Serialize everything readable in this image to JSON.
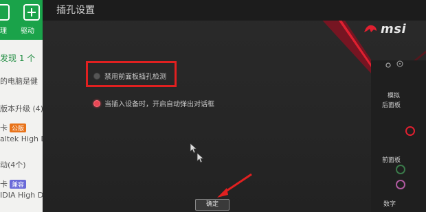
{
  "background_app": {
    "toolbar": [
      {
        "label": "理",
        "icon": "wrench-icon"
      },
      {
        "label": "驱动",
        "icon": "driver-icon"
      }
    ],
    "lines": [
      {
        "text": "发现 1 个",
        "style": "green"
      },
      {
        "text": "的电脑是健"
      },
      {
        "text": "版本升级 (4)"
      },
      {
        "text": "卡",
        "tag": "公版",
        "tag_color": "#e8731a"
      },
      {
        "text": "altek High D"
      },
      {
        "text": "动(4个)"
      },
      {
        "text": "卡",
        "tag": "兼容",
        "tag_color": "#6a6ad8"
      },
      {
        "text": "IDIA High D"
      }
    ]
  },
  "dialog": {
    "title": "插孔设置",
    "brand": "msi",
    "options": [
      {
        "label": "禁用前面板插孔检测",
        "selected": false
      },
      {
        "label": "当插入设备时，开启自动弹出对话框",
        "selected": true
      }
    ],
    "confirm_label": "确定"
  },
  "side_panel": {
    "analog_label": "模拟",
    "rear_label": "后面板",
    "front_label": "前面板",
    "digital_label": "数字"
  },
  "colors": {
    "accent_red": "#e02030",
    "highlight_box": "#e02020",
    "annotation_arrow": "#e02020"
  }
}
